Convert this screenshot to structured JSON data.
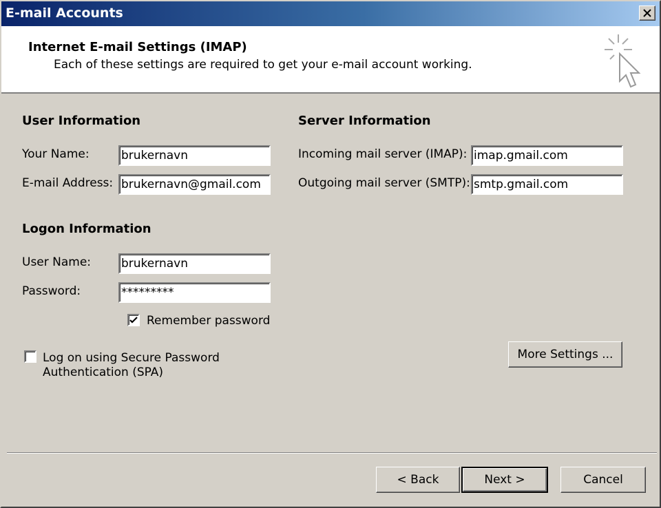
{
  "window": {
    "title": "E-mail Accounts"
  },
  "header": {
    "title": "Internet E-mail Settings (IMAP)",
    "subtitle": "Each of these settings are required to get your e-mail account working."
  },
  "user_info": {
    "heading": "User Information",
    "name_label": "Your Name:",
    "name_value": "brukernavn",
    "email_label": "E-mail Address:",
    "email_value": "brukernavn@gmail.com"
  },
  "server_info": {
    "heading": "Server Information",
    "incoming_label": "Incoming mail server (IMAP):",
    "incoming_value": "imap.gmail.com",
    "outgoing_label": "Outgoing mail server (SMTP):",
    "outgoing_value": "smtp.gmail.com"
  },
  "logon_info": {
    "heading": "Logon Information",
    "user_label": "User Name:",
    "user_value": "brukernavn",
    "password_label": "Password:",
    "password_value": "*********",
    "remember_label": "Remember password",
    "remember_checked": true,
    "spa_label_line1": "Log on using Secure Password",
    "spa_label_line2": "Authentication (SPA)",
    "spa_checked": false
  },
  "buttons": {
    "more_settings": "More Settings ...",
    "back": "< Back",
    "next": "Next >",
    "cancel": "Cancel"
  },
  "icons": {
    "close": "close-icon",
    "wizard": "cursor-sparkle-icon",
    "checkmark": "checkmark-icon"
  }
}
